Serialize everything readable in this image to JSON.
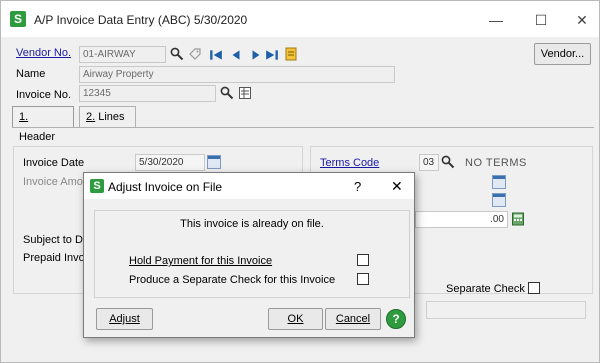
{
  "window": {
    "title": "A/P Invoice Data Entry (ABC) 5/30/2020",
    "logo": "S",
    "minimize_icon": "—",
    "maximize_icon": "☐",
    "close_icon": "✕"
  },
  "header": {
    "vendor_no_label": "Vendor No.",
    "vendor_no_value": "01-AIRWAY",
    "name_label": "Name",
    "name_value": "Airway Property",
    "invoice_no_label": "Invoice No.",
    "invoice_no_value": "12345",
    "vendor_button": "Vendor..."
  },
  "tabs": [
    {
      "num": "1.",
      "label": " Header"
    },
    {
      "num": "2.",
      "label": " Lines"
    }
  ],
  "form": {
    "invoice_date_label": "Invoice Date",
    "invoice_date_value": "5/30/2020",
    "invoice_amount_label": "Invoice Amoun",
    "terms_code_label": "Terms Code",
    "terms_code_value": "03",
    "terms_desc": "NO TERMS",
    "amount_value": ".00",
    "subject_to_disc_label": "Subject to Disc",
    "prepaid_label": "Prepaid Invoic",
    "separate_check_label": "Separate Check"
  },
  "dialog": {
    "title": "Adjust Invoice on File",
    "logo": "S",
    "help_glyph": "?",
    "close_glyph": "✕",
    "message": "This invoice is already on file.",
    "hold_payment_label": "Hold Payment for this Invoice",
    "separate_check_label": "Produce a Separate Check for this Invoice",
    "adjust_button": "Adjust",
    "ok_button": "OK",
    "cancel_button": "Cancel",
    "help_button": "?"
  },
  "colors": {
    "brand_green": "#2e9b3e",
    "link_blue": "#1a1aa6"
  }
}
